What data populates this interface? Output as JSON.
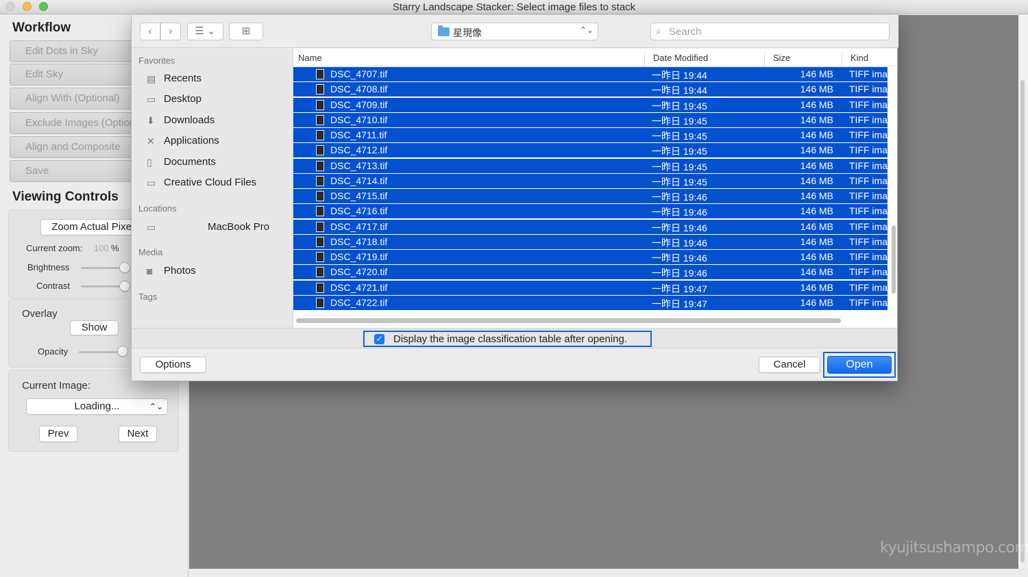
{
  "window": {
    "title": "Starry Landscape Stacker: Select image files to stack"
  },
  "workflow": {
    "title": "Workflow",
    "buttons": [
      "Edit Dots in Sky",
      "Edit Sky",
      "Align With (Optional)",
      "Exclude Images (Optional)",
      "Align and Composite",
      "Save"
    ]
  },
  "viewing": {
    "title": "Viewing Controls",
    "zoom_button": "Zoom Actual Pixels",
    "zoom_label": "Current zoom:",
    "zoom_value": "100",
    "zoom_unit": "%",
    "brightness_label": "Brightness",
    "contrast_label": "Contrast",
    "overlay_label": "Overlay",
    "show_button": "Show",
    "opacity_label": "Opacity"
  },
  "current_image": {
    "label": "Current Image:",
    "select_value": "Loading...",
    "prev": "Prev",
    "next": "Next"
  },
  "dialog": {
    "location": "星現像",
    "search_placeholder": "Search",
    "sidebar": {
      "favorites_head": "Favorites",
      "favorites": [
        {
          "label": "Recents",
          "icon": "recents-icon"
        },
        {
          "label": "Desktop",
          "icon": "desktop-icon"
        },
        {
          "label": "Downloads",
          "icon": "downloads-icon"
        },
        {
          "label": "Applications",
          "icon": "applications-icon"
        },
        {
          "label": "Documents",
          "icon": "documents-icon"
        },
        {
          "label": "Creative Cloud Files",
          "icon": "folder-icon"
        }
      ],
      "locations_head": "Locations",
      "locations": [
        {
          "label": "MacBook Pro",
          "icon": "laptop-icon"
        }
      ],
      "media_head": "Media",
      "media": [
        {
          "label": "Photos",
          "icon": "camera-icon"
        }
      ],
      "tags_head": "Tags"
    },
    "columns": {
      "name": "Name",
      "date": "Date Modified",
      "size": "Size",
      "kind": "Kind"
    },
    "files": [
      {
        "name": "DSC_4707.tif",
        "date": "一昨日 19:44",
        "size": "146 MB",
        "kind": "TIFF ima"
      },
      {
        "name": "DSC_4708.tif",
        "date": "一昨日 19:44",
        "size": "146 MB",
        "kind": "TIFF ima"
      },
      {
        "name": "DSC_4709.tif",
        "date": "一昨日 19:45",
        "size": "146 MB",
        "kind": "TIFF ima"
      },
      {
        "name": "DSC_4710.tif",
        "date": "一昨日 19:45",
        "size": "146 MB",
        "kind": "TIFF ima"
      },
      {
        "name": "DSC_4711.tif",
        "date": "一昨日 19:45",
        "size": "146 MB",
        "kind": "TIFF ima"
      },
      {
        "name": "DSC_4712.tif",
        "date": "一昨日 19:45",
        "size": "146 MB",
        "kind": "TIFF ima"
      },
      {
        "name": "DSC_4713.tif",
        "date": "一昨日 19:45",
        "size": "146 MB",
        "kind": "TIFF ima"
      },
      {
        "name": "DSC_4714.tif",
        "date": "一昨日 19:45",
        "size": "146 MB",
        "kind": "TIFF ima"
      },
      {
        "name": "DSC_4715.tif",
        "date": "一昨日 19:46",
        "size": "146 MB",
        "kind": "TIFF ima"
      },
      {
        "name": "DSC_4716.tif",
        "date": "一昨日 19:46",
        "size": "146 MB",
        "kind": "TIFF ima"
      },
      {
        "name": "DSC_4717.tif",
        "date": "一昨日 19:46",
        "size": "146 MB",
        "kind": "TIFF ima"
      },
      {
        "name": "DSC_4718.tif",
        "date": "一昨日 19:46",
        "size": "146 MB",
        "kind": "TIFF ima"
      },
      {
        "name": "DSC_4719.tif",
        "date": "一昨日 19:46",
        "size": "146 MB",
        "kind": "TIFF ima"
      },
      {
        "name": "DSC_4720.tif",
        "date": "一昨日 19:46",
        "size": "146 MB",
        "kind": "TIFF ima"
      },
      {
        "name": "DSC_4721.tif",
        "date": "一昨日 19:47",
        "size": "146 MB",
        "kind": "TIFF ima"
      },
      {
        "name": "DSC_4722.tif",
        "date": "一昨日 19:47",
        "size": "146 MB",
        "kind": "TIFF ima"
      }
    ],
    "checkbox_label": "Display the image classification table after opening.",
    "options": "Options",
    "cancel": "Cancel",
    "open": "Open"
  },
  "watermark": "kyujitsushampo.com",
  "colors": {
    "selection": "#0451d0",
    "accent": "#1f5fd6"
  }
}
